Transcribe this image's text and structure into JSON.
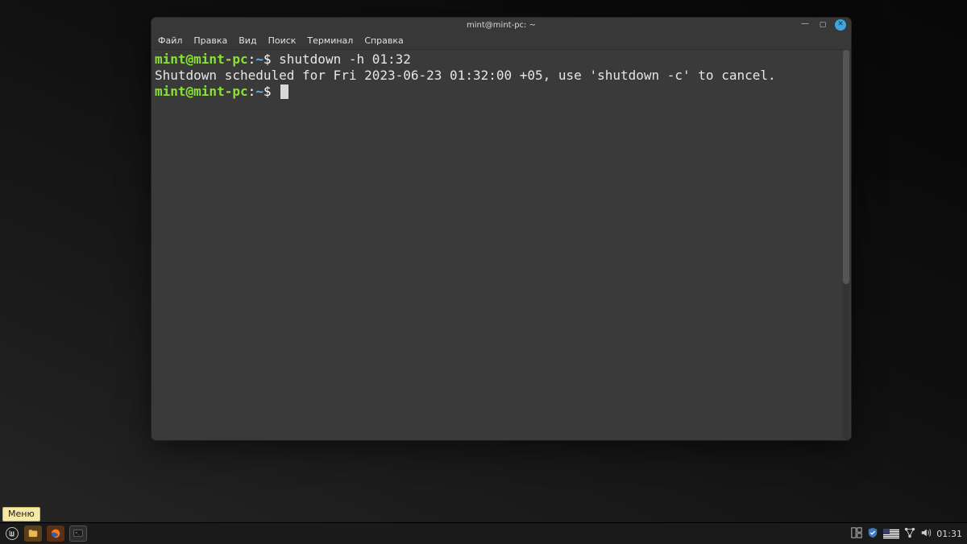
{
  "window": {
    "title": "mint@mint-pc: ~",
    "menu": {
      "file": "Файл",
      "edit": "Правка",
      "view": "Вид",
      "search": "Поиск",
      "terminal": "Терминал",
      "help": "Справка"
    }
  },
  "terminal": {
    "prompt1": {
      "user": "mint@mint-pc",
      "sep": ":",
      "path": "~",
      "dollar": "$ ",
      "command": "shutdown -h 01:32"
    },
    "output1": "Shutdown scheduled for Fri 2023-06-23 01:32:00 +05, use 'shutdown -c' to cancel.",
    "prompt2": {
      "user": "mint@mint-pc",
      "sep": ":",
      "path": "~",
      "dollar": "$ "
    }
  },
  "panel": {
    "tooltip": "Меню",
    "clock": "01:31"
  }
}
